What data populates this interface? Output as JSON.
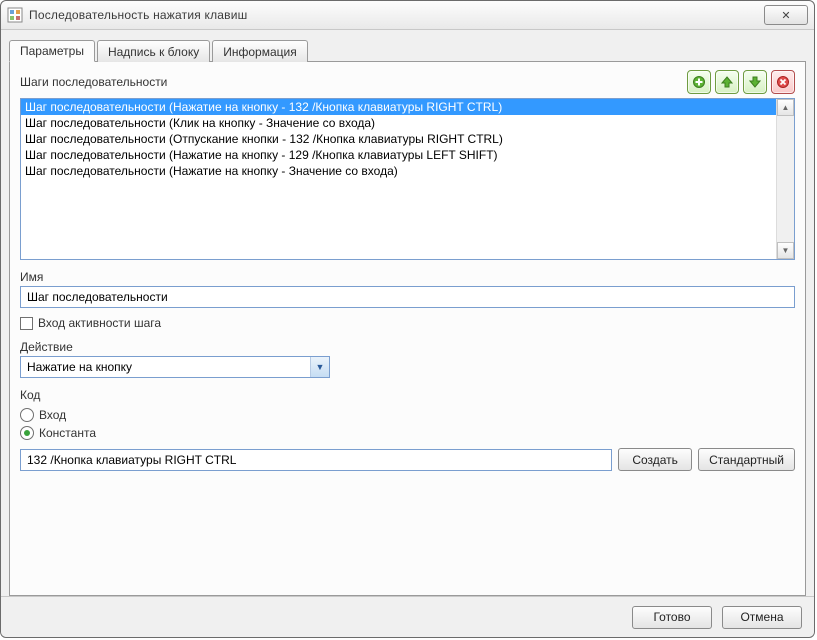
{
  "window": {
    "title": "Последовательность нажатия клавиш",
    "closeGlyph": "✕"
  },
  "tabs": {
    "t0": "Параметры",
    "t1": "Надпись к блоку",
    "t2": "Информация"
  },
  "steps": {
    "label": "Шаги последовательности",
    "items": [
      "Шаг последовательности (Нажатие на кнопку - 132 /Кнопка клавиатуры RIGHT CTRL)",
      "Шаг последовательности (Клик на кнопку - Значение со входа)",
      "Шаг последовательности (Отпускание кнопки - 132 /Кнопка клавиатуры RIGHT CTRL)",
      "Шаг последовательности (Нажатие на кнопку - 129 /Кнопка клавиатуры LEFT SHIFT)",
      "Шаг последовательности (Нажатие на кнопку - Значение со входа)"
    ],
    "selectedIndex": 0
  },
  "name": {
    "label": "Имя",
    "value": "Шаг последовательности"
  },
  "activityCheckbox": {
    "label": "Вход активности шага",
    "checked": false
  },
  "action": {
    "label": "Действие",
    "value": "Нажатие на кнопку"
  },
  "code": {
    "label": "Код",
    "radio_input": "Вход",
    "radio_const": "Константа",
    "selected": "const",
    "value": "132 /Кнопка клавиатуры RIGHT CTRL",
    "btn_create": "Создать",
    "btn_std": "Стандартный"
  },
  "footer": {
    "ok": "Готово",
    "cancel": "Отмена"
  }
}
